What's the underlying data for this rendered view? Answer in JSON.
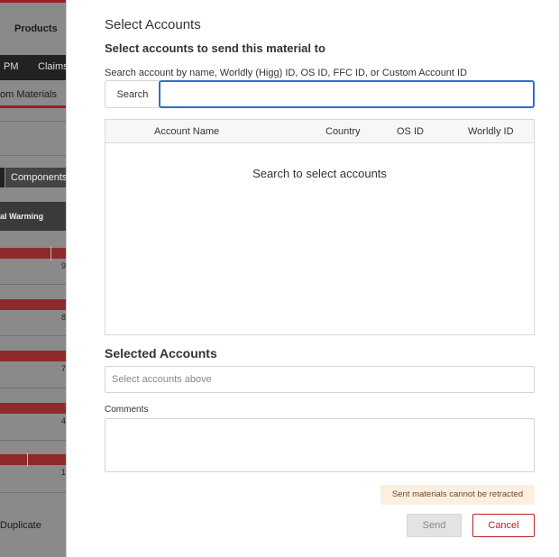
{
  "background": {
    "products_tab": "Products",
    "nav_items": [
      "PM",
      "Claims"
    ],
    "custom_materials_tab": "om Materials",
    "components_tab": "Components",
    "impact_header": "al Warming",
    "bar_values": [
      "9",
      "8",
      "7",
      "4",
      "1"
    ],
    "duplicate_label": "Duplicate",
    "accent_color": "#9c1f1f"
  },
  "modal": {
    "title": "Select Accounts",
    "subtitle": "Select accounts to send this material to",
    "search_label": "Search account by name, Worldly (Higg) ID, OS ID, FFC ID, or Custom Account ID",
    "search_button": "Search",
    "search_value": "",
    "table": {
      "columns": [
        "Account Name",
        "Country",
        "OS ID",
        "Worldly ID"
      ],
      "empty_message": "Search to select accounts"
    },
    "selected_title": "Selected Accounts",
    "selected_placeholder": "Select accounts above",
    "comments_label": "Comments",
    "comments_value": "",
    "warning": "Sent materials cannot be retracted",
    "send_label": "Send",
    "cancel_label": "Cancel",
    "focus_color": "#2f6fc8",
    "cancel_color": "#b32424"
  }
}
